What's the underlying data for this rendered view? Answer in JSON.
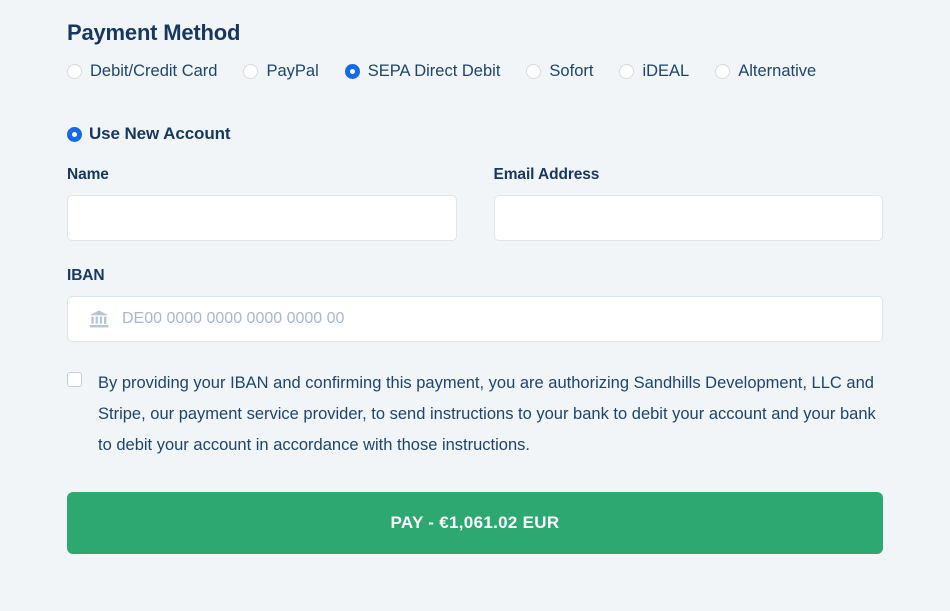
{
  "section": {
    "title": "Payment Method"
  },
  "payment_methods": [
    {
      "label": "Debit/Credit Card",
      "selected": false
    },
    {
      "label": "PayPal",
      "selected": false
    },
    {
      "label": "SEPA Direct Debit",
      "selected": true
    },
    {
      "label": "Sofort",
      "selected": false
    },
    {
      "label": "iDEAL",
      "selected": false
    },
    {
      "label": "Alternative",
      "selected": false
    }
  ],
  "account": {
    "use_new_account_label": "Use New Account",
    "selected": true
  },
  "form": {
    "name": {
      "label": "Name",
      "value": "",
      "placeholder": ""
    },
    "email": {
      "label": "Email Address",
      "value": "",
      "placeholder": ""
    },
    "iban": {
      "label": "IBAN",
      "value": "",
      "placeholder": "DE00 0000 0000 0000 0000 00",
      "icon": "bank-icon"
    }
  },
  "consent": {
    "checked": false,
    "text": "By providing your IBAN and confirming this payment, you are authorizing Sandhills Development, LLC and Stripe, our payment service provider, to send instructions to your bank to debit your account and your bank to debit your account in accordance with those instructions."
  },
  "pay_button": {
    "label": "PAY - €1,061.02 EUR",
    "amount": "1,061.02",
    "currency": "EUR",
    "currency_symbol": "€"
  },
  "colors": {
    "background": "#f1f5f8",
    "heading": "#17375e",
    "text": "#20456b",
    "accent_blue": "#1669e8",
    "pay_green": "#2ea871",
    "input_border": "#dde5ed",
    "placeholder": "#a9b8c9"
  }
}
